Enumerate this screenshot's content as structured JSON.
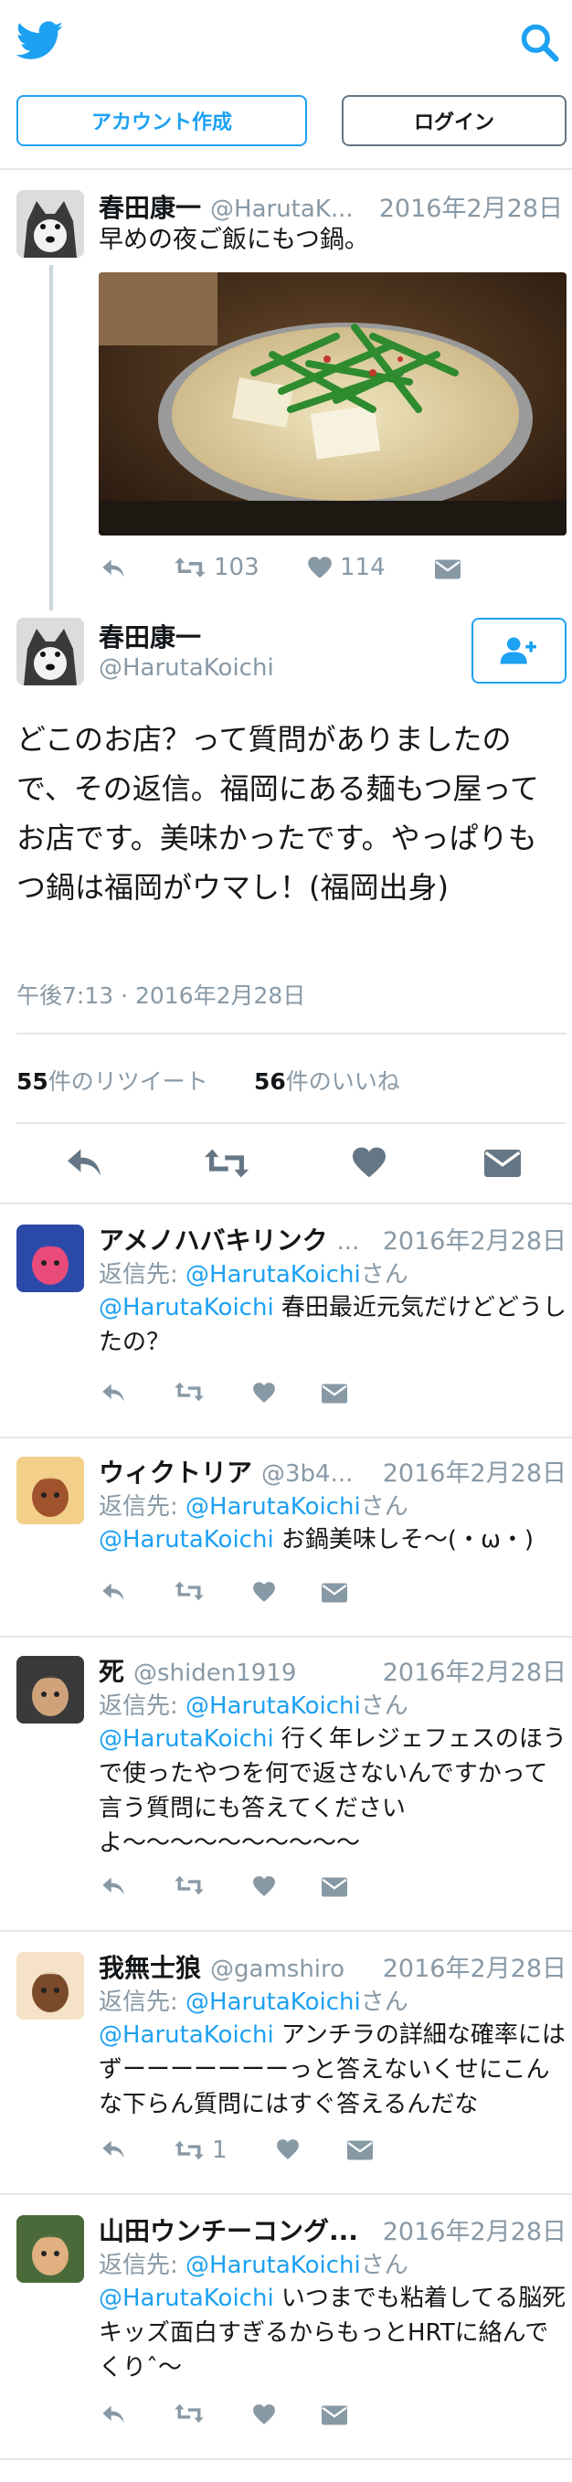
{
  "header": {
    "logo_icon": "twitter-bird-icon",
    "search_icon": "search-icon",
    "signup_label": "アカウント作成",
    "login_label": "ログイン"
  },
  "parent_tweet": {
    "name": "春田康一",
    "handle": "@HarutaK...",
    "date": "2016年2月28日",
    "text": "早めの夜ご飯にもつ鍋。",
    "retweets": "103",
    "likes": "114"
  },
  "main_tweet": {
    "name": "春田康一",
    "handle": "@HarutaKoichi",
    "text": "どこのお店？って質問がありましたので、その返信。福岡にある麺もつ屋ってお店です。美味かったです。やっぱりもつ鍋は福岡がウマし！(福岡出身)",
    "timestamp": "午後7:13 · 2016年2月28日",
    "retweet_count": "55",
    "retweet_label": "件のリツイート",
    "like_count": "56",
    "like_label": "件のいいね"
  },
  "reply_prefix": "返信先: ",
  "reply_suffix": "さん",
  "replies": [
    {
      "name": "アメノハバキリンク",
      "handle": "...",
      "date": "2016年2月28日",
      "reply_to": "@HarutaKoichi",
      "mention": "@HarutaKoichi",
      "text": " 春田最近元気だけどどうしたの？",
      "retweets": ""
    },
    {
      "name": "ウィクトリア",
      "handle": "@3b4...",
      "date": "2016年2月28日",
      "reply_to": "@HarutaKoichi",
      "mention": "@HarutaKoichi",
      "text": " お鍋美味しそ〜(・ω・)",
      "retweets": ""
    },
    {
      "name": "死",
      "handle": "@shiden1919",
      "date": "2016年2月28日",
      "reply_to": "@HarutaKoichi",
      "mention": "@HarutaKoichi",
      "text": " 行く年レジェフェスのほうで使ったやつを何で返さないんですかって言う質問にも答えてくださいよ〜〜〜〜〜〜〜〜〜〜",
      "retweets": ""
    },
    {
      "name": "我無士狼",
      "handle": "@gamshiro",
      "date": "2016年2月28日",
      "reply_to": "@HarutaKoichi",
      "mention": "@HarutaKoichi",
      "text": " アンチラの詳細な確率にはずーーーーーーーっと答えないくせにこんな下らん質問にはすぐ答えるんだな",
      "retweets": "1"
    },
    {
      "name": "山田ウンチーコング...",
      "handle": "",
      "date": "2016年2月28日",
      "reply_to": "@HarutaKoichi",
      "mention": "@HarutaKoichi",
      "text": " いつまでも粘着してる脳死キッズ面白すぎるからもっとHRTに絡んでくりˆ〜",
      "retweets": ""
    }
  ],
  "colors": {
    "brand": "#1da1f2",
    "muted": "#8899a6",
    "divider": "#e1e8ed"
  }
}
